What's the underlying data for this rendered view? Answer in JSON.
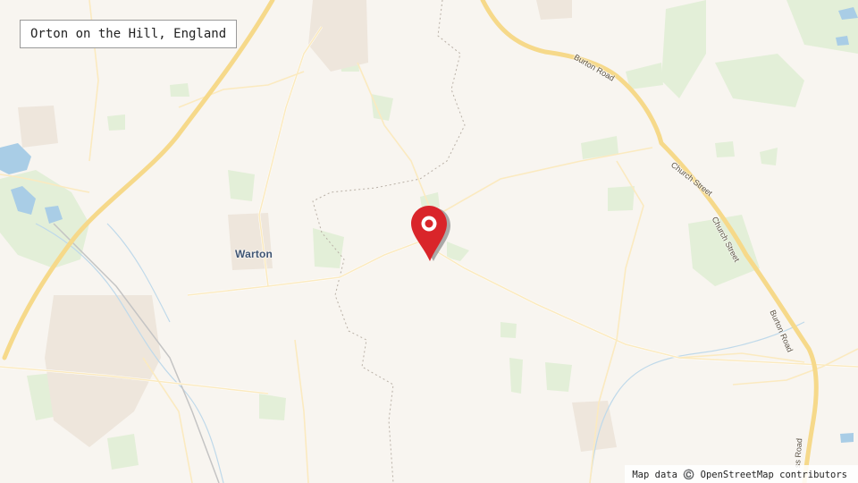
{
  "title": "Orton on the Hill, England",
  "places": {
    "warton": "Warton"
  },
  "roads": {
    "burton_road_north": "Burton Road",
    "church_street_1": "Church Street",
    "church_street_2": "Church Street",
    "burton_road_east": "Burton Road",
    "road_south": "ss Road"
  },
  "marker": {
    "icon": "map-pin-icon",
    "color": "#d9252a"
  },
  "attribution": "Map data ©️ OpenStreetMap contributors"
}
